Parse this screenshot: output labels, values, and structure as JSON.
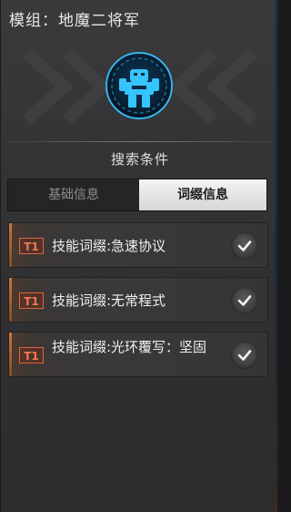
{
  "header": {
    "title": "模组：地魔二将军"
  },
  "emblem": {
    "icon": "cyan-mech-emblem-icon",
    "glow_color": "#2aa8e8"
  },
  "search": {
    "label": "搜索条件"
  },
  "tabs": [
    {
      "label": "基础信息",
      "selected": false
    },
    {
      "label": "词缀信息",
      "selected": true
    }
  ],
  "affixes": [
    {
      "tier": "T1",
      "text": "技能词缀:急速协议",
      "checked": true
    },
    {
      "tier": "T1",
      "text": "技能词缀:无常程式",
      "checked": true
    },
    {
      "tier": "T1",
      "text": "技能词缀:光环覆写：坚固",
      "checked": true
    }
  ],
  "colors": {
    "tier_accent": "#e0633e",
    "selected_tab": "#e6e6e6",
    "panel_bg": "#323234"
  }
}
